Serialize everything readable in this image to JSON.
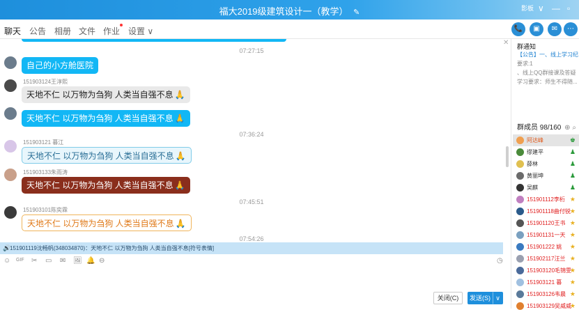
{
  "window": {
    "title": "福大2019级建筑设计一（教学）",
    "edit_icon": "✎",
    "user_label": "影板",
    "ctrl_down": "∨",
    "ctrl_min": "—",
    "ctrl_max": "▫",
    "ctrl_close": "✕"
  },
  "tabs": [
    "聊天",
    "公告",
    "相册",
    "文件",
    "作业",
    "设置"
  ],
  "tab_settings_caret": "∨",
  "actions": [
    "📞",
    "▣",
    "✉",
    "⋯"
  ],
  "messages": [
    {
      "type": "time",
      "text": "07:27:15"
    },
    {
      "type": "msg",
      "sender": "",
      "text": "自己的小方舱医院",
      "style": "blue",
      "emoji": ""
    },
    {
      "type": "msg",
      "sender": "151903124王淳熙",
      "text": "天地不仁 以万物为刍狗 人类当自强不息",
      "style": "gray",
      "emoji": "🙏"
    },
    {
      "type": "msg",
      "sender": "",
      "text": "天地不仁 以万物为刍狗 人类当自强不息",
      "style": "blue",
      "emoji": "🙏"
    },
    {
      "type": "time",
      "text": "07:36:24"
    },
    {
      "type": "msg",
      "sender": "151903121  暮江",
      "text": "天地不仁 以万物为刍狗 人类当自强不息",
      "style": "light",
      "emoji": "🙏"
    },
    {
      "type": "msg",
      "sender": "151903133朱雨涛",
      "text": "天地不仁 以万物为刍狗 人类当自强不息",
      "style": "brown",
      "emoji": "🙏"
    },
    {
      "type": "time",
      "text": "07:45:51"
    },
    {
      "type": "msg",
      "sender": "151903101陈奕霖",
      "text": "天地不仁 以万物为刍狗 人类当自强不息",
      "style": "orange",
      "emoji": "🙏"
    },
    {
      "type": "time",
      "text": "07:54:26"
    }
  ],
  "notice_bar": {
    "speaker": "🔊",
    "text": "151901119沈畅帆(348034870)：天地不仁 以万物为刍狗 人类当自强不息[符号表情]"
  },
  "toolbar": [
    "☺",
    "GIF",
    "✂",
    "▭",
    "✉",
    "🖼",
    "🔔",
    "⊖"
  ],
  "history_icon": "◷",
  "buttons": {
    "close": "关闭(C)",
    "send": "发送(S)",
    "send_arrow": "∨"
  },
  "announcement": {
    "title": "群通知",
    "lines": [
      "【公告】一、线上学习纪律",
      "要求:1",
      "、线上QQ群接课及答疑",
      "学习要求：师生不得随..."
    ]
  },
  "members_header": {
    "label": "群成员 98/160",
    "icons": "⊕ ⌕"
  },
  "members": [
    {
      "name": "阿达峰",
      "role": "♚",
      "color": "#e05a1c",
      "sel": true
    },
    {
      "name": "缪建平",
      "role": "♟",
      "color": "#333",
      "sel": false
    },
    {
      "name": "薛林",
      "role": "♟",
      "color": "#333",
      "sel": false
    },
    {
      "name": "黄丽坤",
      "role": "♟",
      "color": "#333",
      "sel": false
    },
    {
      "name": "吴麒",
      "role": "♟",
      "color": "#333",
      "sel": false
    },
    {
      "name": "151901112李桁",
      "role": "★",
      "color": "#e02020",
      "sel": false
    },
    {
      "name": "151901118曲付锐",
      "role": "★",
      "color": "#e02020",
      "sel": false
    },
    {
      "name": "151901120王书",
      "role": "★",
      "color": "#e02020",
      "sel": false
    },
    {
      "name": "151901131一天",
      "role": "★",
      "color": "#e02020",
      "sel": false
    },
    {
      "name": "151901222  姚",
      "role": "★",
      "color": "#e02020",
      "sel": false
    },
    {
      "name": "151902117汪兰",
      "role": "★",
      "color": "#e02020",
      "sel": false
    },
    {
      "name": "151903120毛锦雯",
      "role": "★",
      "color": "#e02020",
      "sel": false
    },
    {
      "name": "151903121  暮",
      "role": "★",
      "color": "#e02020",
      "sel": false
    },
    {
      "name": "151903126韦晨",
      "role": "★",
      "color": "#e02020",
      "sel": false
    },
    {
      "name": "151903129吴威威",
      "role": "★",
      "color": "#e02020",
      "sel": false
    }
  ],
  "colors": {
    "accent": "#1e8fdc",
    "bubble_blue": "#12b7f5",
    "member_red": "#e02020"
  }
}
